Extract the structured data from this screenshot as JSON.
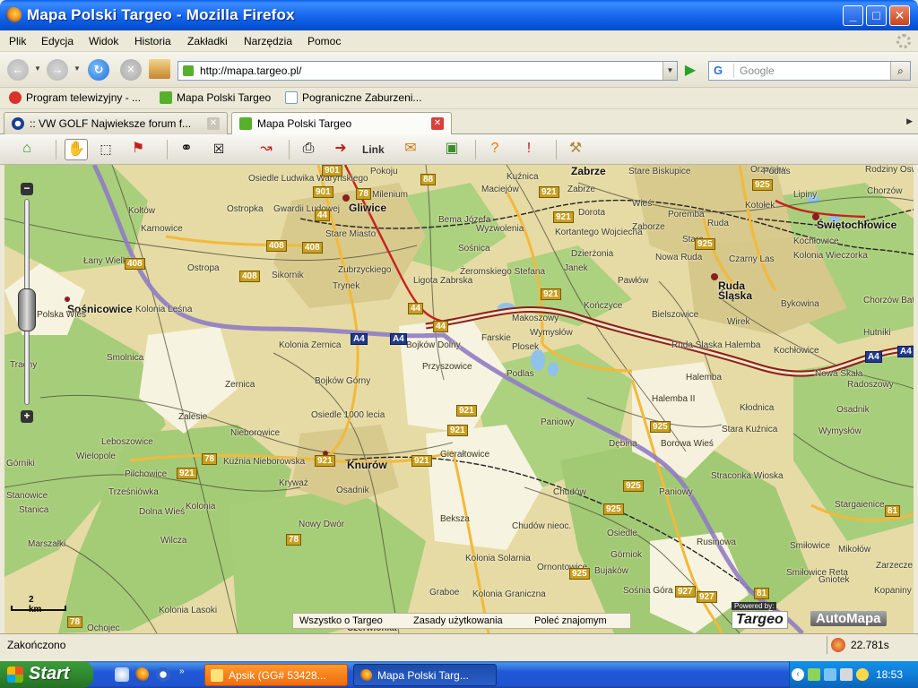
{
  "window": {
    "title": "Mapa Polski Targeo - Mozilla Firefox",
    "controls": {
      "minimize": "_",
      "maximize": "□",
      "close": "✕"
    }
  },
  "menu": [
    "Plik",
    "Edycja",
    "Widok",
    "Historia",
    "Zakładki",
    "Narzędzia",
    "Pomoc"
  ],
  "navigation": {
    "url": "http://mapa.targeo.pl/",
    "search_placeholder": "Google",
    "search_engine_letter": "G",
    "icons": [
      "back-icon",
      "forward-icon",
      "reload-icon",
      "stop-icon",
      "home-icon",
      "go-icon",
      "search-icon"
    ]
  },
  "bookmarks": [
    {
      "label": "Program telewizyjny - ...",
      "color": "#d9322b"
    },
    {
      "label": "Mapa Polski Targeo",
      "color": "#57b02b"
    },
    {
      "label": "Pograniczne Zaburzeni...",
      "color": "#ffffff"
    }
  ],
  "tabs": [
    {
      "label": ":: VW GOLF Najwieksze forum f...",
      "active": false
    },
    {
      "label": "Mapa Polski Targeo",
      "active": true
    }
  ],
  "map_toolbar": {
    "link_label": "Link",
    "tools": [
      "map-home-icon",
      "hand-pan-icon",
      "select-rectangle-icon",
      "route-flag-icon",
      "binoculars-icon",
      "layers-toggle-icon",
      "route-ab-icon",
      "print-icon",
      "link-icon",
      "email-icon",
      "photo-icon",
      "help-icon",
      "feedback-icon",
      "tools-icon"
    ]
  },
  "map": {
    "scale_label": "2 km",
    "zoom_in": "+",
    "zoom_out": "−",
    "cities": [
      {
        "name": "Gliwice",
        "major": true
      },
      {
        "name": "Zabrze",
        "major": true
      },
      {
        "name": "Knurów",
        "major": true
      },
      {
        "name": "Sośnicowice",
        "major": true
      },
      {
        "name": "Ruda Śląska",
        "major": true
      },
      {
        "name": "Świętochłowice",
        "major": true
      }
    ],
    "places": [
      "Osiedle Ludwika Waryńskiego",
      "Pokoju",
      "Kuźnica",
      "Maciejów",
      "Zabrze",
      "Stare Biskupice",
      "Milenium",
      "Orzegów",
      "Podlas",
      "Rodziny Oswaldów",
      "Chorzów",
      "Lipiny",
      "Kotołek",
      "Kołtów",
      "Karnowice",
      "Ostropka",
      "Gwardii Ludowej",
      "Bema Józefa",
      "Wyzwolenia",
      "Dorota",
      "Wieś",
      "Poremba",
      "Ruda",
      "Kochłowice",
      "Kolonia Wieczorka",
      "Stare Miasto",
      "Zubrzyckiego",
      "Sośnica",
      "Kortantego Wojciecha",
      "Zaborze",
      "Stara",
      "Nowa Ruda",
      "Czarny Las",
      "Łany Wielkie",
      "Ostropa",
      "Sikornik",
      "Trynek",
      "Ligota Zabrska",
      "Żeromskiego Stefana",
      "Janek",
      "Dzierżonia",
      "Pawłów",
      "Chorzów Batory",
      "Polska Wieś",
      "Kolonia Leśna",
      "Makoszowy",
      "Kończyce",
      "Bielszowice",
      "Bykowina",
      "Wirek",
      "Hutniki",
      "Smolnica",
      "Kolonia Zernica",
      "Bojków Dolny",
      "Wymysłów",
      "Farskie",
      "Plosek",
      "Ruda Śląska Halemba",
      "Kochłowice",
      "Przyszowice",
      "Podlas",
      "Halemba",
      "Nowa Skała",
      "Radoszowy",
      "Trachy",
      "Zernica",
      "Bojków Górny",
      "Halemba II",
      "Kłodnica",
      "Osadnik",
      "Zalesie",
      "Osiedle 1000 lecia",
      "Paniowy",
      "Stara Kuźnica",
      "Wymysłów",
      "Nieborowice",
      "Dębina",
      "Borowa Wieś",
      "Wielopole",
      "Leboszowice",
      "Pilchowice",
      "Kuźnia Nieborowska",
      "Gierałtowice",
      "Chudów",
      "Paniowy",
      "Stanowice",
      "Trześniówka",
      "Kryważ",
      "Osadnik",
      "Straconka Wioska",
      "Stargaienice",
      "Górniki",
      "Stanica",
      "Kolonia",
      "Dolna Wieś",
      "Nowy Dwór",
      "Beksza",
      "Chudów nieoc.",
      "Osiedle",
      "Rusinowa",
      "Wilcza",
      "Górniok",
      "Smiłowice",
      "Mikołów",
      "Marszałki",
      "Kolonia Solarnia",
      "Bujaków",
      "Ornontowice",
      "Smiłowice Reta",
      "Zarzecze",
      "Graboe",
      "Kolonia Graniczna",
      "Sośnia Góra",
      "Gniotek",
      "Kopaniny Lewe",
      "Kolonia Lasoki",
      "Ochojec",
      "Czerwionka"
    ],
    "roads": [
      "901",
      "78",
      "88",
      "921",
      "44",
      "408",
      "A4",
      "925",
      "81",
      "927"
    ]
  },
  "footer_links": [
    "Wszystko o Targeo",
    "Zasady użytkowania",
    "Poleć znajomym"
  ],
  "branding": {
    "powered_by": "Powered by:",
    "targeo": "Targeo",
    "automapa": "AutoMapa"
  },
  "status": {
    "text": "Zakończono",
    "timing": "22.781s"
  },
  "taskbar": {
    "start_label": "Start",
    "tasks": [
      {
        "label": "Apsik (GG# 53428...",
        "active": false
      },
      {
        "label": "Mapa Polski Targ...",
        "active": true
      }
    ],
    "clock": "18:53"
  }
}
